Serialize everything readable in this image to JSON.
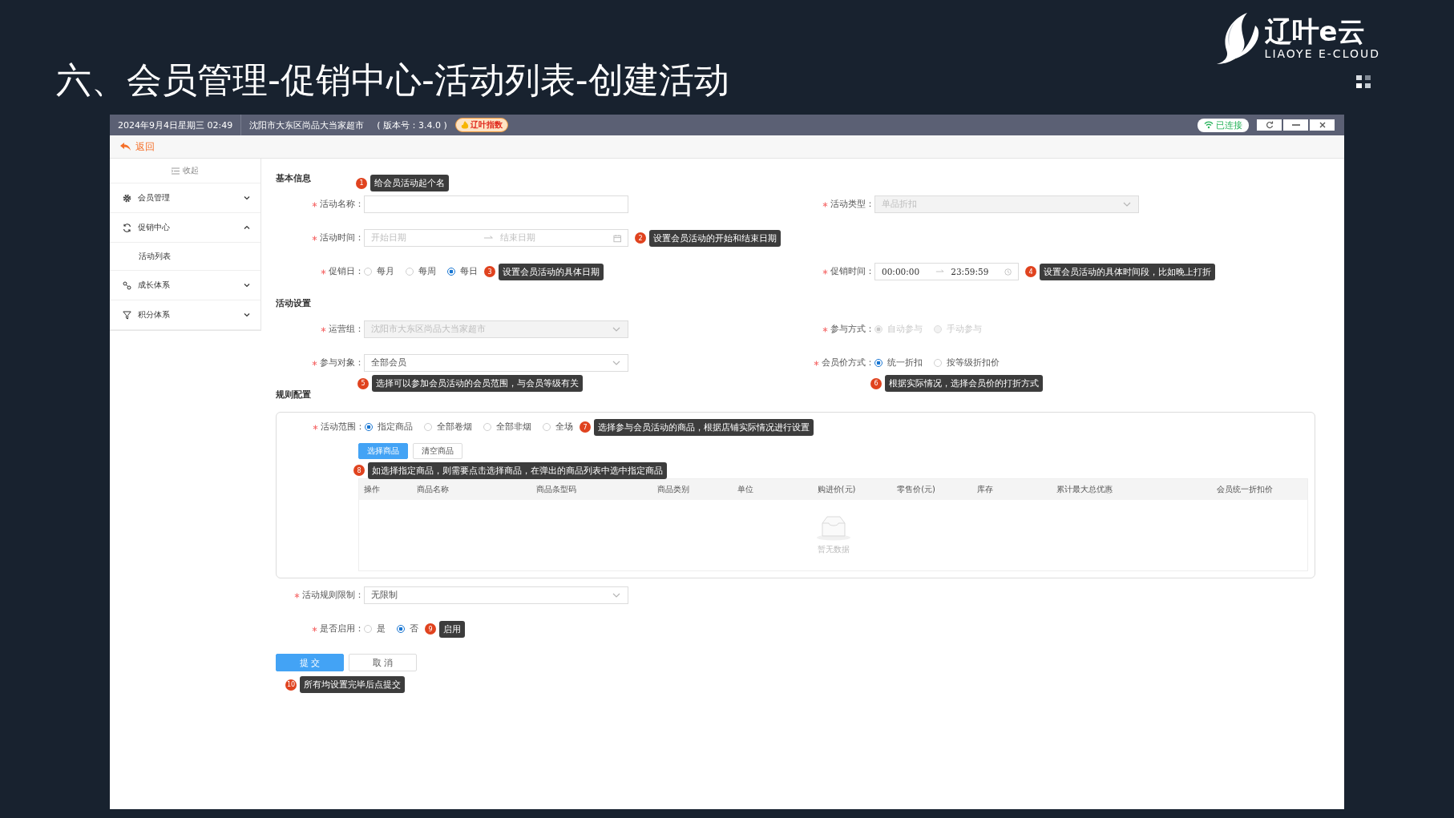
{
  "slide_title": "六、会员管理-促销中心-活动列表-创建活动",
  "logo": {
    "name": "辽叶e云",
    "tagline": "LIAOYE E-CLOUD"
  },
  "window": {
    "datetime": "2024年9月4日星期三 02:49",
    "store": "沈阳市大东区尚品大当家超市",
    "version": "( 版本号：3.4.0 )",
    "index_badge": "辽叶指数",
    "connection": "已连接"
  },
  "back": "返回",
  "sidebar": {
    "collapse": "收起",
    "items": [
      {
        "label": "会员管理",
        "expanded": false
      },
      {
        "label": "促销中心",
        "expanded": true,
        "children": [
          {
            "label": "活动列表"
          }
        ]
      },
      {
        "label": "成长体系",
        "expanded": false
      },
      {
        "label": "积分体系",
        "expanded": false
      }
    ]
  },
  "form": {
    "blocks": [
      {
        "kind": "section",
        "title": "基本信息"
      },
      {
        "kind": "row",
        "left": {
          "label": "活动名称：",
          "kind": "input",
          "required": true,
          "disabled": false,
          "note_above": {
            "number": "1",
            "text": "给会员活动起个名"
          }
        },
        "right": {
          "label": "活动类型：",
          "kind": "select",
          "required": true,
          "disabled": true,
          "value": "单品折扣"
        }
      },
      {
        "kind": "row",
        "left": {
          "label": "活动时间：",
          "kind": "date_range",
          "required": true,
          "disabled": false,
          "start_placeholder": "开始日期",
          "end_placeholder": "结束日期",
          "note": {
            "number": "2",
            "text": "设置会员活动的开始和结束日期"
          }
        }
      },
      {
        "kind": "row",
        "left": {
          "label": "促销日：",
          "kind": "radio",
          "required": true,
          "disabled": false,
          "options": [
            {
              "label": "每月",
              "selected": false
            },
            {
              "label": "每周",
              "selected": false
            },
            {
              "label": "每日",
              "selected": true
            }
          ],
          "note": {
            "number": "3",
            "text": "设置会员活动的具体日期"
          }
        },
        "right": {
          "label": "促销时间：",
          "kind": "time_range",
          "required": true,
          "disabled": false,
          "start": "00:00:00",
          "end": "23:59:59",
          "note": {
            "number": "4",
            "text": "设置会员活动的具体时间段，比如晚上打折"
          }
        }
      },
      {
        "kind": "section",
        "title": "活动设置"
      },
      {
        "kind": "row",
        "left": {
          "label": "运营组：",
          "kind": "select",
          "required": true,
          "disabled": true,
          "value": "沈阳市大东区尚品大当家超市"
        },
        "right": {
          "label": "参与方式：",
          "kind": "radio",
          "required": true,
          "disabled": true,
          "options": [
            {
              "label": "自动参与",
              "selected": true
            },
            {
              "label": "手动参与",
              "selected": false
            }
          ]
        }
      },
      {
        "kind": "row",
        "left": {
          "label": "参与对象：",
          "kind": "select",
          "required": true,
          "disabled": false,
          "value": "全部会员",
          "note_below": {
            "number": "5",
            "text": "选择可以参加会员活动的会员范围，与会员等级有关"
          }
        },
        "right": {
          "label": "会员价方式：",
          "kind": "radio",
          "required": true,
          "disabled": false,
          "options": [
            {
              "label": "统一折扣",
              "selected": true
            },
            {
              "label": "按等级折扣价",
              "selected": false
            }
          ],
          "note_below": {
            "number": "6",
            "text": "根据实际情况，选择会员价的打折方式"
          }
        }
      },
      {
        "kind": "section",
        "title": "规则配置"
      },
      {
        "kind": "panel",
        "field": {
          "label": "活动范围：",
          "kind": "radio",
          "required": true,
          "disabled": false,
          "options": [
            {
              "label": "指定商品",
              "selected": true
            },
            {
              "label": "全部卷烟",
              "selected": false
            },
            {
              "label": "全部非烟",
              "selected": false
            },
            {
              "label": "全场",
              "selected": false
            }
          ],
          "note": {
            "number": "7",
            "text": "选择参与会员活动的商品，根据店铺实际情况进行设置"
          }
        },
        "buttons": [
          {
            "label": "选择商品",
            "primary": true
          },
          {
            "label": "清空商品",
            "primary": false
          }
        ],
        "note": {
          "number": "8",
          "text": "如选择指定商品，则需要点击选择商品，在弹出的商品列表中选中指定商品"
        },
        "table": {
          "columns": [
            "操作",
            "商品名称",
            "商品条型码",
            "商品类别",
            "单位",
            "购进价(元)",
            "零售价(元)",
            "库存",
            "累计最大总优惠",
            "会员统一折扣价"
          ],
          "empty_text": "暂无数据"
        }
      },
      {
        "kind": "row",
        "left": {
          "label": "活动规则限制：",
          "kind": "select",
          "required": true,
          "disabled": false,
          "value": "无限制"
        }
      },
      {
        "kind": "row",
        "left": {
          "label": "是否启用：",
          "kind": "radio",
          "required": true,
          "disabled": false,
          "options": [
            {
              "label": "是",
              "selected": false
            },
            {
              "label": "否",
              "selected": true
            }
          ],
          "note": {
            "number": "9",
            "text": "启用"
          }
        }
      },
      {
        "kind": "actions",
        "buttons": [
          {
            "label": "提 交",
            "primary": true
          },
          {
            "label": "取 消",
            "primary": false
          }
        ],
        "note": {
          "number": "10",
          "text": "所有均设置完毕后点提交"
        }
      }
    ]
  }
}
